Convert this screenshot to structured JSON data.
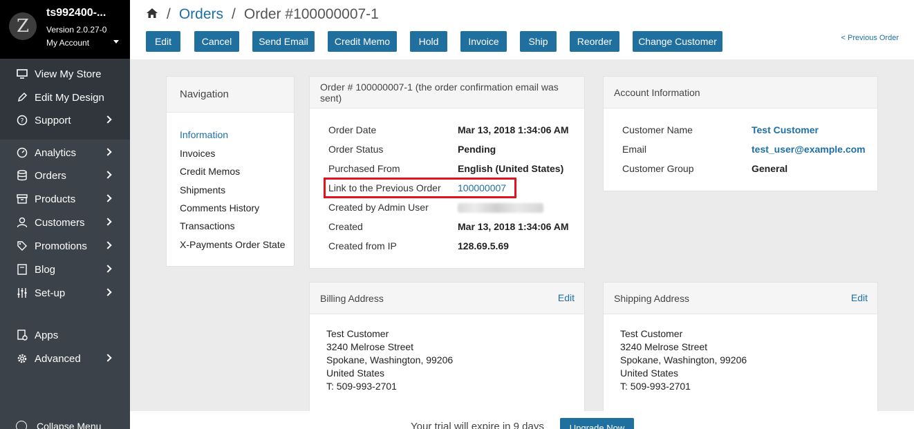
{
  "sidebar": {
    "logo_letter": "Z",
    "store_name": "ts992400-...",
    "version": "Version 2.0.27-0",
    "account": "My Account",
    "top_items": [
      {
        "label": "View My Store",
        "icon": "monitor-icon"
      },
      {
        "label": "Edit My Design",
        "icon": "pencil-icon"
      },
      {
        "label": "Support",
        "icon": "help-circle-icon"
      }
    ],
    "items": [
      {
        "label": "Analytics",
        "icon": "gauge-icon"
      },
      {
        "label": "Orders",
        "icon": "database-icon"
      },
      {
        "label": "Products",
        "icon": "box-icon"
      },
      {
        "label": "Customers",
        "icon": "user-icon"
      },
      {
        "label": "Promotions",
        "icon": "tag-icon"
      },
      {
        "label": "Blog",
        "icon": "book-icon"
      },
      {
        "label": "Set-up",
        "icon": "sliders-icon"
      }
    ],
    "extra_items": [
      {
        "label": "Apps",
        "icon": "apps-icon"
      },
      {
        "label": "Advanced",
        "icon": "gear-icon"
      }
    ],
    "collapse": "Collapse Menu"
  },
  "header": {
    "breadcrumb": {
      "section": "Orders",
      "current": "Order #100000007-1"
    },
    "buttons": [
      "Edit",
      "Cancel",
      "Send Email",
      "Credit Memo",
      "Hold",
      "Invoice",
      "Ship",
      "Reorder",
      "Change Customer"
    ],
    "previous_order": "< Previous Order"
  },
  "navigation": {
    "title": "Navigation",
    "links": [
      "Information",
      "Invoices",
      "Credit Memos",
      "Shipments",
      "Comments History",
      "Transactions",
      "X-Payments Order State"
    ],
    "active": "Information"
  },
  "order": {
    "title": "Order # 100000007-1 (the order confirmation email was sent)",
    "rows": [
      {
        "label": "Order Date",
        "value": "Mar 13, 2018 1:34:06 AM"
      },
      {
        "label": "Order Status",
        "value": "Pending"
      },
      {
        "label": "Purchased From",
        "value": "English (United States)"
      },
      {
        "label": "Link to the Previous Order",
        "value": "100000007"
      },
      {
        "label": "Created by Admin User",
        "value": ""
      },
      {
        "label": "Created",
        "value": "Mar 13, 2018 1:34:06 AM"
      },
      {
        "label": "Created from IP",
        "value": "128.69.5.69"
      }
    ]
  },
  "account": {
    "title": "Account Information",
    "rows": [
      {
        "label": "Customer Name",
        "value": "Test Customer"
      },
      {
        "label": "Email",
        "value": "test_user@example.com"
      },
      {
        "label": "Customer Group",
        "value": "General"
      }
    ]
  },
  "billing": {
    "title": "Billing Address",
    "edit": "Edit",
    "lines": [
      "Test Customer",
      "3240 Melrose Street",
      "Spokane, Washington, 99206",
      "United States",
      "T: 509-993-2701"
    ]
  },
  "shipping": {
    "title": "Shipping Address",
    "edit": "Edit",
    "lines": [
      "Test Customer",
      "3240 Melrose Street",
      "Spokane, Washington, 99206",
      "United States",
      "T: 509-993-2701"
    ]
  },
  "trial": {
    "text": "Your trial will expire in 9 days",
    "button": "Upgrade Now"
  },
  "colors": {
    "accent": "#1f6f9f",
    "highlight": "#e3121d",
    "sidebar": "#3b4249"
  }
}
